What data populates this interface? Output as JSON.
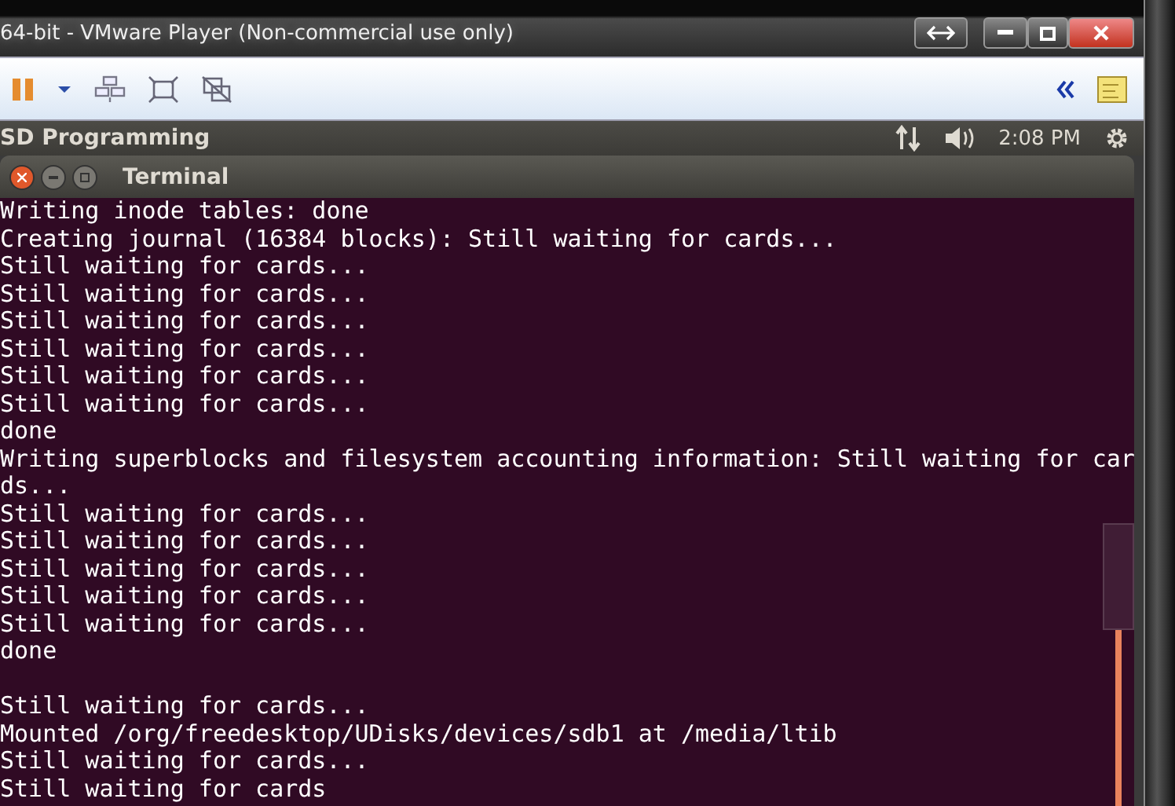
{
  "window": {
    "title": "64-bit - VMware Player (Non-commercial use only)"
  },
  "toolbar": {
    "paused": true
  },
  "panel": {
    "title": "SD Programming",
    "clock": "2:08 PM"
  },
  "terminal": {
    "title": "Terminal",
    "lines": [
      {
        "text": "Writing inode tables: done"
      },
      {
        "text": "Creating journal (16384 blocks): Still waiting for cards..."
      },
      {
        "text": "Still waiting for cards..."
      },
      {
        "text": "Still waiting for cards..."
      },
      {
        "text": "Still waiting for cards..."
      },
      {
        "text": "Still waiting for cards..."
      },
      {
        "text": "Still waiting for cards..."
      },
      {
        "text": "Still waiting for cards..."
      },
      {
        "text": "done"
      },
      {
        "text": "Writing superblocks and filesystem accounting information: Still waiting for car"
      },
      {
        "text": "ds..."
      },
      {
        "text": "Still waiting for cards..."
      },
      {
        "text": "Still waiting for cards..."
      },
      {
        "text": "Still waiting for cards..."
      },
      {
        "text": "Still waiting for cards..."
      },
      {
        "text": "Still waiting for cards..."
      },
      {
        "text": "done"
      },
      {
        "text": "Still waiting for cards...",
        "blank_before": true
      },
      {
        "text": "Mounted /org/freedesktop/UDisks/devices/sdb1 at /media/ltib"
      },
      {
        "text": "Still waiting for cards..."
      },
      {
        "text": "Still waiting for cards"
      }
    ]
  }
}
